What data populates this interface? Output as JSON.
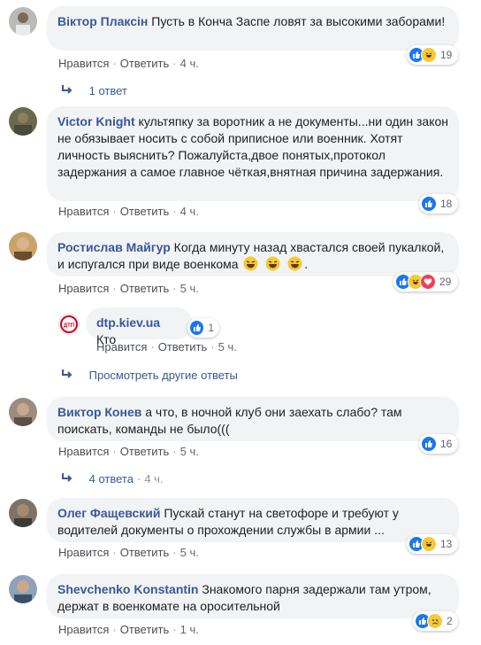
{
  "comments": [
    {
      "author": "Віктор Плаксін",
      "text": "Пусть в Конча Заспе ловят за высокими заборами!",
      "like_label": "Нравится",
      "reply_label": "Ответить",
      "time": "4 ч.",
      "reaction_count": "19",
      "reactions": [
        "like-icon",
        "haha-icon"
      ],
      "replies_link": "1 ответ"
    },
    {
      "author": "Victor Knight",
      "text": "культяпку за воротник а не документы...ни один закон не обязывает носить с собой приписное или военник. Хотят личность выяснить? Пожалуйста,двое понятых,протокол задержания а самое главное чёткая,внятная причина задержания.",
      "like_label": "Нравится",
      "reply_label": "Ответить",
      "time": "4 ч.",
      "reaction_count": "18",
      "reactions": [
        "like-icon"
      ]
    },
    {
      "author": "Ростислав Майгур",
      "text": "Когда минуту назад хвастался своей пукалкой, и испугался при виде военкома",
      "text_end": ".",
      "like_label": "Нравится",
      "reply_label": "Ответить",
      "time": "5 ч.",
      "reaction_count": "29",
      "reactions": [
        "like-icon",
        "haha-icon",
        "love-icon"
      ],
      "reply": {
        "author": "dtp.kiev.ua",
        "avatar_text": "ДТП",
        "text": "Кто",
        "like_label": "Нравится",
        "reply_label": "Ответить",
        "time": "5 ч.",
        "reaction_count": "1"
      },
      "more_replies_link": "Просмотреть другие ответы"
    },
    {
      "author": "Виктор Конев",
      "text": "а что, в ночной клуб они заехать слабо? там поискать, команды не было(((",
      "like_label": "Нравится",
      "reply_label": "Ответить",
      "time": "5 ч.",
      "reaction_count": "16",
      "reactions": [
        "like-icon"
      ],
      "replies_link": "4 ответа",
      "replies_time": "4 ч."
    },
    {
      "author": "Олег Фащевский",
      "text": "Пускай станут на светофоре и требуют у водителей документы о прохождении службы в армии ...",
      "like_label": "Нравится",
      "reply_label": "Ответить",
      "time": "5 ч.",
      "reaction_count": "13",
      "reactions": [
        "like-icon",
        "haha-icon"
      ]
    },
    {
      "author": "Shevchenko Konstantin",
      "text": "Знакомого парня задержали там утром, держат в военкомате на оросительной",
      "like_label": "Нравится",
      "reply_label": "Ответить",
      "time": "1 ч.",
      "reaction_count": "2",
      "reactions": [
        "like-icon",
        "sad-icon"
      ]
    }
  ],
  "colors": {
    "author": "#385898",
    "bubble": "#f2f3f5",
    "like": "#1877f2",
    "haha": "#f7c933",
    "love": "#f33e58"
  }
}
